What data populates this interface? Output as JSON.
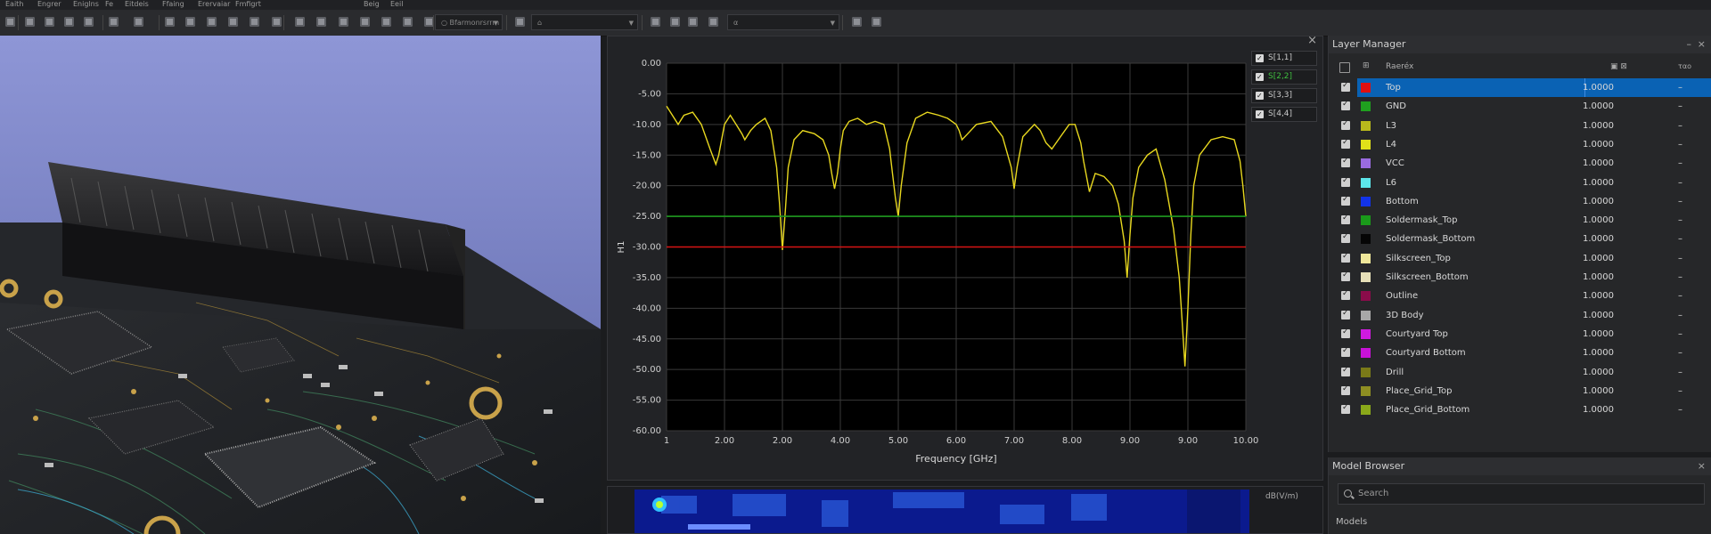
{
  "menu": [
    "Eaith",
    "Engrer",
    "Eniglns",
    "Fe",
    "Eitdeis",
    "Ffaing",
    "Erervaiar",
    "Fmfigrt",
    "Beig",
    "Eeil"
  ],
  "toolbar": {
    "combo1": "○  Bfarmonrsrrm",
    "combo2": "⌂",
    "combo3": "α"
  },
  "chart_data": {
    "type": "line",
    "xlabel": "Frequency [GHz]",
    "ylabel": "H1",
    "x_ticks": [
      "1",
      "2.00",
      "2.00",
      "4.00",
      "5.00",
      "6.00",
      "7.00",
      "8.00",
      "9.00",
      "9.00",
      "10.00"
    ],
    "x_tick_values": [
      1,
      2,
      3,
      4,
      5,
      6,
      7,
      8,
      9,
      10,
      11
    ],
    "y_ticks": [
      "0.00",
      "-5.00",
      "-10.00",
      "-15.00",
      "-20.00",
      "-25.00",
      "-30.00",
      "-35.00",
      "-40.00",
      "-45.00",
      "-50.00",
      "-55.00",
      "-60.00"
    ],
    "xlim": [
      1,
      11
    ],
    "ylim": [
      -60,
      0
    ],
    "grid": true,
    "legend_position": "right",
    "series": [
      {
        "name": "S[1,1]",
        "color": "#e8d81f",
        "x": [
          1.0,
          1.1,
          1.2,
          1.3,
          1.45,
          1.6,
          1.75,
          1.85,
          1.9,
          2.0,
          2.1,
          2.2,
          2.3,
          2.35,
          2.45,
          2.55,
          2.7,
          2.8,
          2.9,
          2.95,
          3.0,
          3.05,
          3.1,
          3.2,
          3.35,
          3.55,
          3.7,
          3.8,
          3.85,
          3.9,
          3.95,
          4.0,
          4.05,
          4.15,
          4.3,
          4.45,
          4.6,
          4.75,
          4.85,
          4.9,
          4.95,
          5.0,
          5.05,
          5.15,
          5.3,
          5.5,
          5.7,
          5.85,
          6.0,
          6.05,
          6.1,
          6.2,
          6.35,
          6.6,
          6.8,
          6.95,
          7.0,
          7.05,
          7.15,
          7.35,
          7.45,
          7.55,
          7.65,
          7.8,
          7.95,
          8.05,
          8.15,
          8.2,
          8.3,
          8.4,
          8.55,
          8.7,
          8.8,
          8.9,
          8.95,
          9.0,
          9.05,
          9.15,
          9.3,
          9.45,
          9.6,
          9.75,
          9.85,
          9.9,
          9.95,
          10.0,
          10.05,
          10.1,
          10.2,
          10.4,
          10.6,
          10.8,
          10.9,
          10.95,
          11.0
        ],
        "y": [
          -7,
          -8.5,
          -10,
          -8.5,
          -8,
          -10,
          -14,
          -16.5,
          -15,
          -10,
          -8.5,
          -10,
          -11.5,
          -12.5,
          -11,
          -10,
          -9,
          -11,
          -17,
          -23,
          -30.5,
          -24,
          -17,
          -12.5,
          -11,
          -11.5,
          -12.5,
          -15,
          -18,
          -20.5,
          -18,
          -14,
          -11,
          -9.5,
          -9,
          -10,
          -9.5,
          -10,
          -14,
          -18,
          -22,
          -25,
          -20,
          -13,
          -9,
          -8,
          -8.5,
          -9,
          -10,
          -11,
          -12.5,
          -11.5,
          -10,
          -9.5,
          -12,
          -17,
          -20.5,
          -17,
          -12,
          -10,
          -11,
          -13,
          -14,
          -12,
          -10,
          -10,
          -13,
          -16,
          -21,
          -18,
          -18.5,
          -20,
          -23,
          -29,
          -35,
          -28,
          -22,
          -17,
          -15,
          -14,
          -19,
          -27,
          -35,
          -42,
          -49.5,
          -40,
          -28,
          -20,
          -15,
          -12.5,
          -12,
          -12.5,
          -16,
          -20,
          -25
        ]
      },
      {
        "name": "S[2,2]",
        "color": "#1f9a1f",
        "x": [
          1,
          11
        ],
        "y": [
          -25,
          -25
        ]
      },
      {
        "name": "S[3,3]",
        "color": "#d61414",
        "x": [
          1,
          11
        ],
        "y": [
          -30,
          -30
        ]
      },
      {
        "name": "S[4,4]",
        "color": "#e8d81f",
        "x": [],
        "y": []
      }
    ]
  },
  "layer_manager": {
    "title": "Layer Manager",
    "col_name": "Raeréx",
    "col_extra": "ταο",
    "layers": [
      {
        "name": "Top",
        "color": "#e01010",
        "value": "1.0000",
        "extra": "–",
        "selected": true
      },
      {
        "name": "GND",
        "color": "#1fa01f",
        "value": "1.0000",
        "extra": "–"
      },
      {
        "name": "L3",
        "color": "#b8b81c",
        "value": "1.0000",
        "extra": "–"
      },
      {
        "name": "L4",
        "color": "#e0e01a",
        "value": "1.0000",
        "extra": "–"
      },
      {
        "name": "VCC",
        "color": "#9a6be0",
        "value": "1.0000",
        "extra": "–"
      },
      {
        "name": "L6",
        "color": "#5ce6ea",
        "value": "1.0000",
        "extra": "–"
      },
      {
        "name": "Bottom",
        "color": "#1233e8",
        "value": "1.0000",
        "extra": "–"
      },
      {
        "name": "Soldermask_Top",
        "color": "#1a9a1a",
        "value": "1.0000",
        "extra": "–"
      },
      {
        "name": "Soldermask_Bottom",
        "color": "#050505",
        "value": "1.0000",
        "extra": "–"
      },
      {
        "name": "Silkscreen_Top",
        "color": "#efe79a",
        "value": "1.0000",
        "extra": "–"
      },
      {
        "name": "Silkscreen_Bottom",
        "color": "#e6e0b8",
        "value": "1.0000",
        "extra": "–"
      },
      {
        "name": "Outline",
        "color": "#8a0c4a",
        "value": "1.0000",
        "extra": "–"
      },
      {
        "name": "3D Body",
        "color": "#a8a8a8",
        "value": "1.0000",
        "extra": "–"
      },
      {
        "name": "Courtyard Top",
        "color": "#d01ae0",
        "value": "1.0000",
        "extra": "–"
      },
      {
        "name": "Courtyard Bottom",
        "color": "#c812d8",
        "value": "1.0000",
        "extra": "–"
      },
      {
        "name": "Drill",
        "color": "#7a7a18",
        "value": "1.0000",
        "extra": "–"
      },
      {
        "name": "Place_Grid_Top",
        "color": "#8e8e22",
        "value": "1.0000",
        "extra": "–"
      },
      {
        "name": "Place_Grid_Bottom",
        "color": "#8aa81a",
        "value": "1.0000",
        "extra": "–"
      }
    ]
  },
  "model_browser": {
    "title": "Model Browser",
    "search_placeholder": "Search",
    "section": "Models"
  },
  "pcb2d": {
    "unit_label": "dB(V/m)"
  }
}
